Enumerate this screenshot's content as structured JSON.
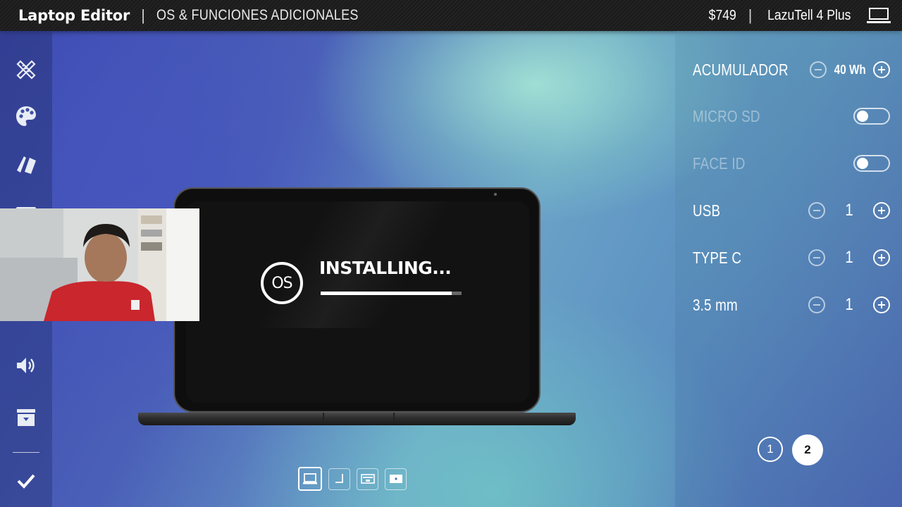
{
  "header": {
    "app_title": "Laptop Editor",
    "separator": "|",
    "section_title": "OS & FUNCIONES ADICIONALES",
    "price": "$749",
    "model": "LazuTell 4 Plus",
    "model_icon": "laptop-icon"
  },
  "sidebar": {
    "tools": [
      {
        "icon": "ruler-pencil-icon"
      },
      {
        "icon": "palette-icon"
      },
      {
        "icon": "material-cards-icon"
      },
      {
        "icon": "keyboard-icon"
      },
      {
        "icon": "ports-icon"
      },
      {
        "icon": "speaker-icon"
      },
      {
        "icon": "archive-box-icon"
      },
      {
        "icon": "checkmark-icon"
      }
    ]
  },
  "screen": {
    "os_logo": "OS",
    "status": "INSTALLING...",
    "progress": 0.93
  },
  "options": {
    "acumulador": {
      "label": "ACUMULADOR",
      "value": "40 Wh"
    },
    "micro_sd": {
      "label": "MICRO SD",
      "enabled": false
    },
    "face_id": {
      "label": "FACE ID",
      "enabled": false
    },
    "usb": {
      "label": "USB",
      "value": "1"
    },
    "type_c": {
      "label": "TYPE C",
      "value": "1"
    },
    "jack": {
      "label": "3.5 mm",
      "value": "1"
    }
  },
  "pager": {
    "page1": "1",
    "page2": "2",
    "current": 2
  },
  "views": [
    {
      "icon": "front-view-icon",
      "active": true
    },
    {
      "icon": "side-view-icon",
      "active": false
    },
    {
      "icon": "keyboard-view-icon",
      "active": false
    },
    {
      "icon": "back-view-icon",
      "active": false
    }
  ],
  "colors": {
    "accent": "#ffffff",
    "topbar": "#1e1e1e",
    "screen": "#121212"
  }
}
